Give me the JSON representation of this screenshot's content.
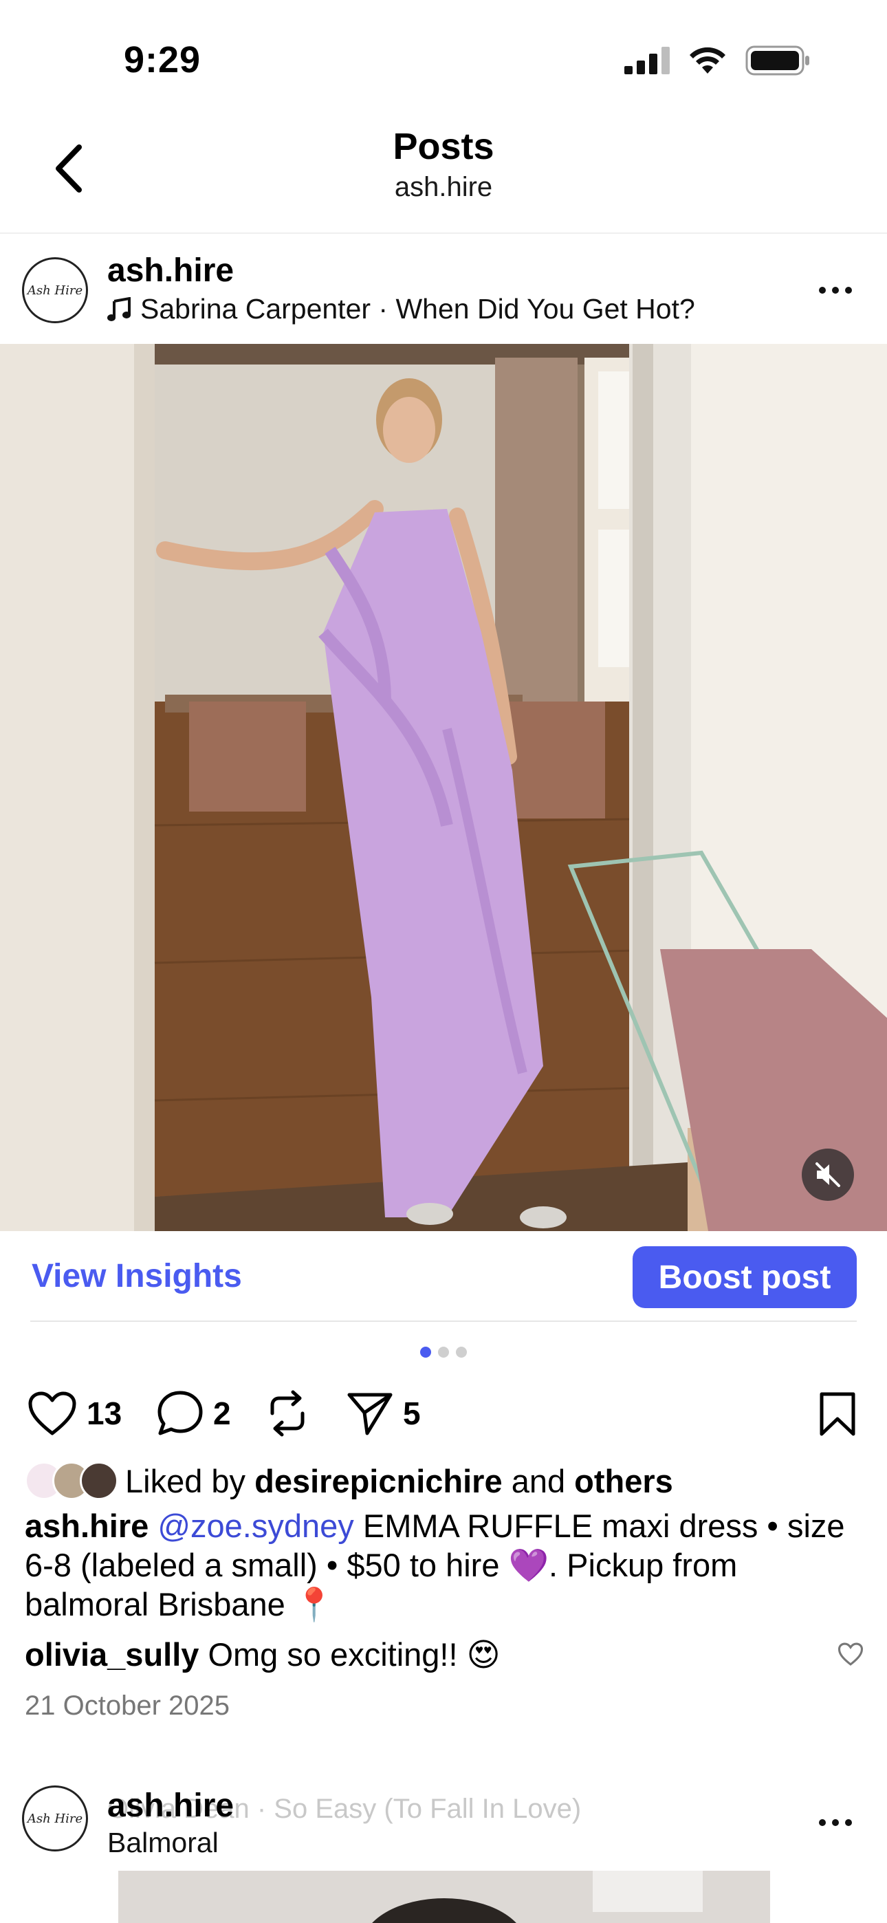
{
  "status_bar": {
    "time": "9:29"
  },
  "header": {
    "title": "Posts",
    "subtitle": "ash.hire"
  },
  "post": {
    "avatar_text": "Ash Hire",
    "username": "ash.hire",
    "music": "Sabrina Carpenter · When Did You Get Hot?",
    "view_insights_label": "View Insights",
    "boost_label": "Boost post",
    "carousel_dots": 3,
    "carousel_active": 0,
    "likes_count": "13",
    "comments_count": "2",
    "shares_count": "5",
    "liked_by_prefix": "Liked by",
    "liked_by_user": "desirepicnichire",
    "liked_by_and": "and",
    "liked_by_others": "others",
    "caption_user": "ash.hire",
    "caption_mention": "@zoe.sydney",
    "caption_text": "EMMA RUFFLE maxi dress • size 6-8 (labeled a small) • $50 to hire 💜. Pickup from balmoral Brisbane 📍",
    "comment_user": "olivia_sully",
    "comment_text": "Omg so exciting!! 😍",
    "date": "21 October 2025",
    "colors": {
      "accent": "#4a5bf0",
      "dress": "#c9a4de",
      "mention": "#3c4ad6"
    }
  },
  "next_post": {
    "avatar_text": "Ash Hire",
    "username": "ash.hire",
    "music": "Olivia Dean · So Easy (To Fall In Love)",
    "location": "Balmoral"
  }
}
